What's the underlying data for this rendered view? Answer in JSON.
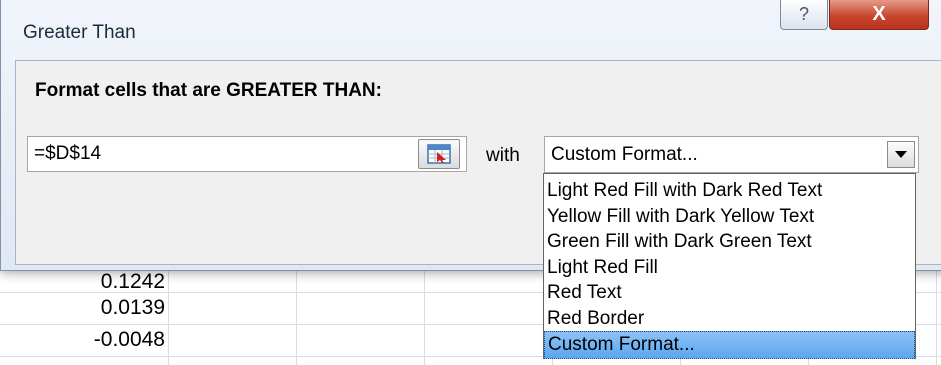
{
  "worksheet": {
    "cells": [
      "0.1242",
      "0.0139",
      "-0.0048"
    ]
  },
  "dialog": {
    "title": "Greater Than",
    "help_icon": "question-mark-icon",
    "close_icon": "close-x-icon",
    "close_label": "X",
    "help_label": "?",
    "prompt": "Format cells that are GREATER THAN:",
    "value": "=$D$14",
    "range_selector_icon": "collapse-range-icon",
    "with_label": "with",
    "format_selected": "Custom Format...",
    "format_options": [
      "Light Red Fill with Dark Red Text",
      "Yellow Fill with Dark Yellow Text",
      "Green Fill with Dark Green Text",
      "Light Red Fill",
      "Red Text",
      "Red Border",
      "Custom Format..."
    ],
    "highlighted_option_index": 6
  },
  "colors": {
    "close_button": "#c84630",
    "selection": "#5aa6f0",
    "dialog_background": "#e1e8f2"
  }
}
